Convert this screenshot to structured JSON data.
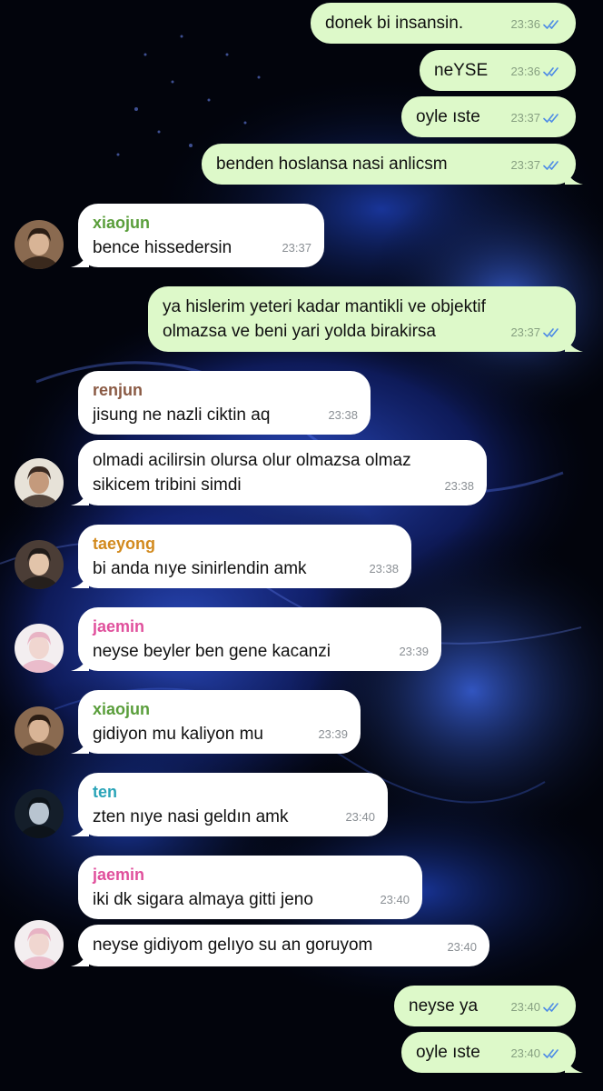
{
  "colors": {
    "outgoing_bubble": "#ddf9c9",
    "incoming_bubble": "#ffffff",
    "read_check": "#4d8be6",
    "timestamp": "#8a8f94",
    "sender_xiaojun": "#5a9e3b",
    "sender_renjun": "#8a5a44",
    "sender_taeyong": "#d28a1e",
    "sender_jaemin": "#e0509c",
    "sender_ten": "#2aa4b8",
    "background": "#02040c"
  },
  "messages": [
    {
      "direction": "out",
      "text": "donek bi insansin.",
      "time": "23:36",
      "status_icon": "double-check-icon"
    },
    {
      "direction": "out",
      "text": "neYSE",
      "time": "23:36",
      "status_icon": "double-check-icon"
    },
    {
      "direction": "out",
      "text": "oyle ıste",
      "time": "23:37",
      "status_icon": "double-check-icon"
    },
    {
      "direction": "out",
      "text": "benden hoslansa nasi anlicsm",
      "time": "23:37",
      "status_icon": "double-check-icon"
    },
    {
      "direction": "in",
      "sender": "xiaojun",
      "text": "bence hissedersin",
      "time": "23:37",
      "avatar": "avatar-xiaojun"
    },
    {
      "direction": "out",
      "text": "ya hislerim yeteri kadar mantikli ve objektif\nolmazsa ve beni yari yolda birakirsa",
      "time": "23:37",
      "status_icon": "double-check-icon"
    },
    {
      "direction": "in",
      "sender": "renjun",
      "text": "jisung ne nazli ciktin aq",
      "time": "23:38"
    },
    {
      "direction": "in",
      "text": "olmadi acilirsin olursa olur olmazsa olmaz\nsikicem tribini simdi",
      "time": "23:38",
      "avatar": "avatar-renjun"
    },
    {
      "direction": "in",
      "sender": "taeyong",
      "text": "bi anda nıye sinirlendin amk",
      "time": "23:38",
      "avatar": "avatar-taeyong"
    },
    {
      "direction": "in",
      "sender": "jaemin",
      "text": "neyse beyler ben gene kacanzi",
      "time": "23:39",
      "avatar": "avatar-jaemin"
    },
    {
      "direction": "in",
      "sender": "xiaojun",
      "text": "gidiyon mu kaliyon mu",
      "time": "23:39",
      "avatar": "avatar-xiaojun"
    },
    {
      "direction": "in",
      "sender": "ten",
      "text": "zten nıye nasi geldın amk",
      "time": "23:40",
      "avatar": "avatar-ten"
    },
    {
      "direction": "in",
      "sender": "jaemin",
      "text": "iki dk sigara almaya gitti jeno",
      "time": "23:40"
    },
    {
      "direction": "in",
      "text": "neyse gidiyom gelıyo su an goruyom",
      "time": "23:40",
      "avatar": "avatar-jaemin"
    },
    {
      "direction": "out",
      "text": "neyse ya",
      "time": "23:40",
      "status_icon": "double-check-icon"
    },
    {
      "direction": "out",
      "text": "oyle ıste",
      "time": "23:40",
      "status_icon": "double-check-icon"
    }
  ]
}
